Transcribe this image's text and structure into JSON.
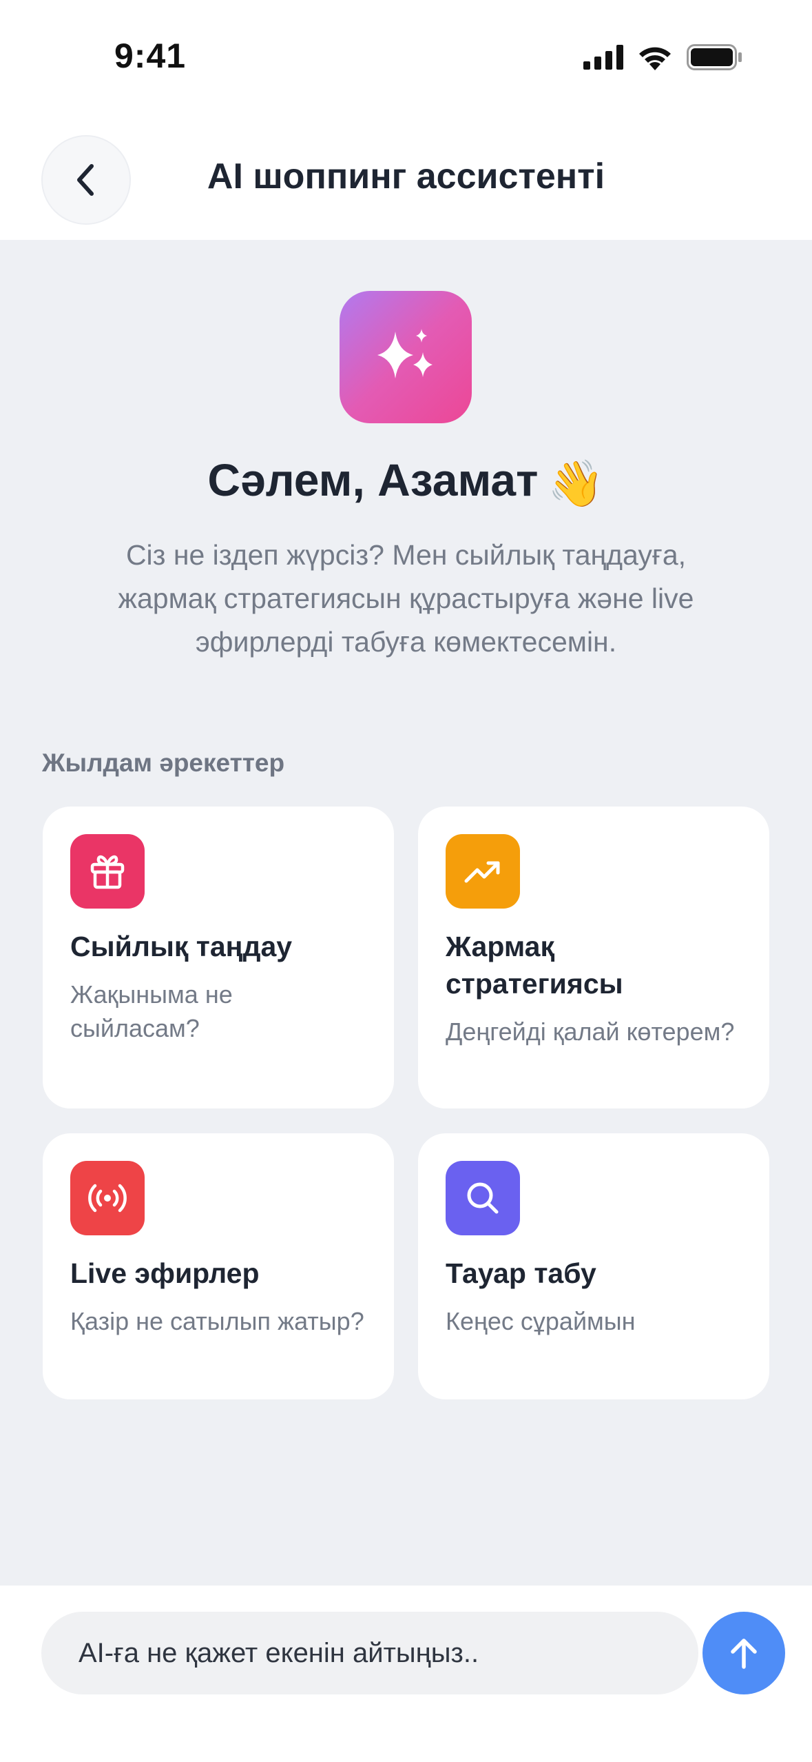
{
  "status_bar": {
    "time": "9:41"
  },
  "header": {
    "title": "AI шоппинг ассистенті"
  },
  "hero": {
    "greeting": "Сәлем, Азамат",
    "emoji": "👋",
    "description": "Сіз не іздеп жүрсіз? Мен сыйлық таңдауға, жармақ стратегиясын құрастыруға және live эфирлерді табуға көмектесемін."
  },
  "quick_actions": {
    "label": "Жылдам әрекеттер",
    "items": [
      {
        "icon": "gift-icon",
        "color": "#ea3566",
        "title": "Сыйлық таңдау",
        "subtitle": "Жақыныма не сыйласам?"
      },
      {
        "icon": "trending-up-icon",
        "color": "#f59e0b",
        "title": "Жармақ стратегиясы",
        "subtitle": "Деңгейді қалай көтерем?"
      },
      {
        "icon": "broadcast-icon",
        "color": "#ee4447",
        "title": "Live эфирлер",
        "subtitle": "Қазір не сатылып жатыр?"
      },
      {
        "icon": "search-icon",
        "color": "#6a61f0",
        "title": "Тауар табу",
        "subtitle": "Кеңес сұраймын"
      }
    ]
  },
  "composer": {
    "placeholder": "AI-ға не қажет екенін айтыңыз..",
    "send_icon": "arrow-up-icon",
    "send_color": "#4f8df7"
  }
}
